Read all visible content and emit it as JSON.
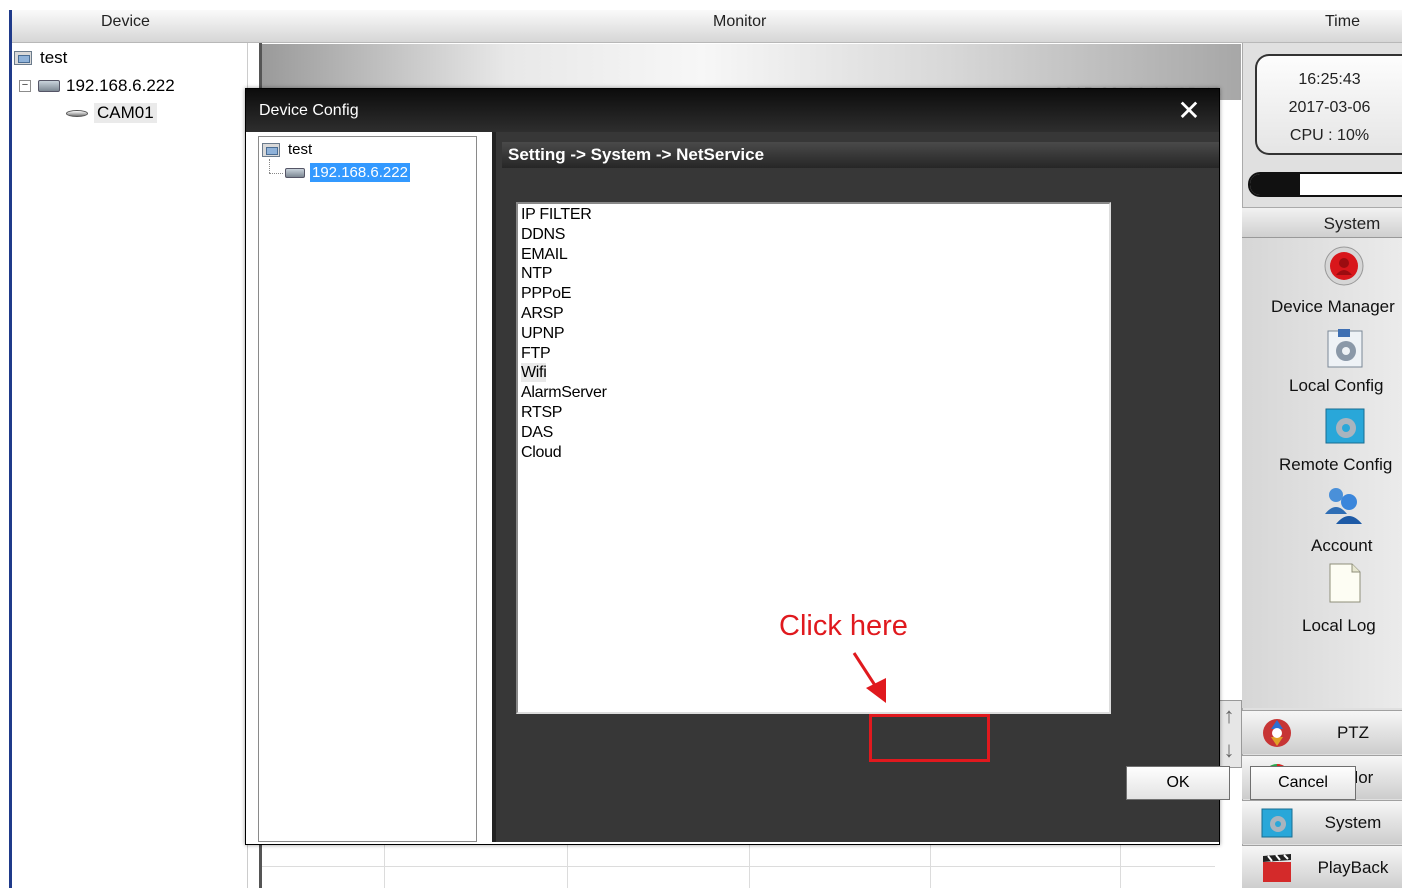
{
  "topbar": {
    "device": "Device",
    "monitor": "Monitor",
    "time": "Time"
  },
  "device_tree": {
    "group": "test",
    "dvr": "192.168.6.222",
    "camera": "CAM01"
  },
  "monitor": {
    "timestamp": "2017-03-06 16:25:43"
  },
  "clock": {
    "time": "16:25:43",
    "date": "2017-03-06",
    "cpu": "CPU : 10%"
  },
  "progress": {
    "level_percent": 33
  },
  "right_panel": {
    "header": "System",
    "tools": [
      {
        "label": "Device Manager",
        "icon": "device-manager-icon"
      },
      {
        "label": "Local Config",
        "icon": "local-config-icon"
      },
      {
        "label": "Remote Config",
        "icon": "remote-config-icon"
      },
      {
        "label": "Account",
        "icon": "account-icon"
      },
      {
        "label": "Local Log",
        "icon": "local-log-icon"
      }
    ],
    "nav": [
      {
        "label": "PTZ",
        "icon": "ptz-icon"
      },
      {
        "label": "Color",
        "icon": "color-icon"
      },
      {
        "label": "System",
        "icon": "system-icon"
      },
      {
        "label": "PlayBack",
        "icon": "playback-icon"
      }
    ]
  },
  "dialog": {
    "title": "Device Config",
    "close_glyph": "✕",
    "tree": {
      "group": "test",
      "device": "192.168.6.222"
    },
    "breadcrumb": "Setting -> System -> NetService",
    "services": [
      "IP FILTER",
      "DDNS",
      "EMAIL",
      "NTP",
      "PPPoE",
      "ARSP",
      "UPNP",
      "FTP",
      "Wifi",
      "AlarmServer",
      "RTSP",
      "DAS",
      "Cloud"
    ],
    "selected_service": "Wifi",
    "ok_label": "OK",
    "cancel_label": "Cancel"
  },
  "annotation": {
    "text": "Click here",
    "color": "#e0191e"
  }
}
